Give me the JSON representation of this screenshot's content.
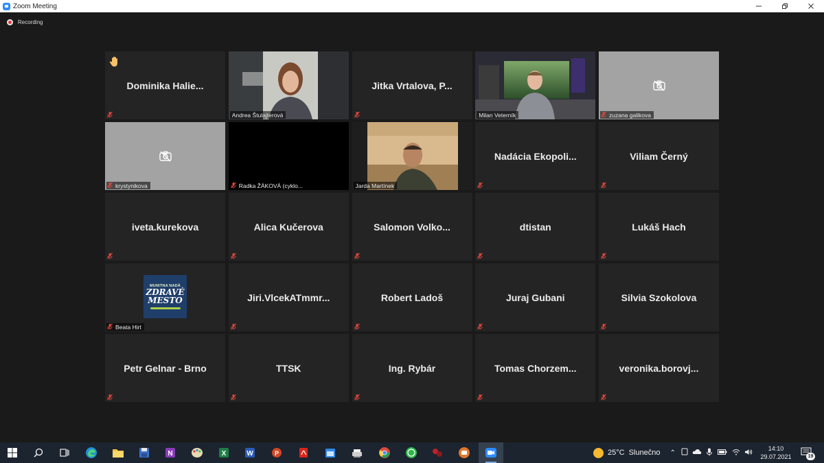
{
  "window": {
    "title": "Zoom Meeting"
  },
  "recording": {
    "label": "Recording"
  },
  "participants": [
    {
      "name": "Dominika  Halie...",
      "display": "name",
      "hand_raised": true,
      "muted": true
    },
    {
      "name": "Andrea Štulajterová",
      "display": "video",
      "active_speaker": true
    },
    {
      "name": "Jitka  Vrtalova,  P...",
      "display": "name",
      "muted": true
    },
    {
      "name": "Milan Veterník",
      "display": "video"
    },
    {
      "name": "zuzana galikova",
      "display": "camera-off",
      "muted": true
    },
    {
      "name": "krystynikova",
      "display": "camera-off",
      "muted": true
    },
    {
      "name": "Radka ŽÁKOVÁ (cyklo...",
      "display": "black",
      "muted": true
    },
    {
      "name": "Jarda Martínek",
      "display": "video"
    },
    {
      "name": "Nadácia  Ekopoli...",
      "display": "name",
      "muted": true
    },
    {
      "name": "Viliam Černý",
      "display": "name",
      "muted": true
    },
    {
      "name": "iveta.kurekova",
      "display": "name",
      "muted": true
    },
    {
      "name": "Alica Kučerova",
      "display": "name",
      "muted": true
    },
    {
      "name": "Salomon  Volko...",
      "display": "name",
      "muted": true
    },
    {
      "name": "dtistan",
      "display": "name",
      "muted": true
    },
    {
      "name": "Lukáš Hach",
      "display": "name",
      "muted": true
    },
    {
      "name": "Beata Hirt",
      "display": "logo",
      "muted": true,
      "logo_text": [
        "MUNITNA NADÁ",
        "ZDRAVÉ",
        "MESTO"
      ]
    },
    {
      "name": "Jiri.VlcekATmmr...",
      "display": "name",
      "muted": true
    },
    {
      "name": "Robert Ladoš",
      "display": "name",
      "muted": true
    },
    {
      "name": "Juraj Gubani",
      "display": "name",
      "muted": true
    },
    {
      "name": "Silvia Szokolova",
      "display": "name",
      "muted": true
    },
    {
      "name": "Petr Gelnar - Brno",
      "display": "name",
      "muted": true
    },
    {
      "name": "TTSK",
      "display": "name",
      "muted": true
    },
    {
      "name": "Ing. Rybár",
      "display": "name",
      "muted": true
    },
    {
      "name": "Tomas  Chorzem...",
      "display": "name",
      "muted": true
    },
    {
      "name": "veronika.borovj...",
      "display": "name",
      "muted": true
    }
  ],
  "taskbar": {
    "apps": [
      "start-icon",
      "search-icon",
      "task-view-icon",
      "edge-icon",
      "file-explorer-icon",
      "save-icon",
      "onenote-icon",
      "paint-icon",
      "excel-icon",
      "word-icon",
      "powerpoint-icon",
      "acrobat-icon",
      "calendar-icon",
      "scanner-icon",
      "chrome-icon",
      "whatsapp-icon",
      "app-red-icon",
      "app-orange-icon",
      "zoom-icon"
    ],
    "weather": {
      "temp": "25°C",
      "condition": "Slunečno"
    },
    "time": "14:10",
    "date": "29.07.2021",
    "notifications": "19"
  },
  "colors": {
    "tile_bg": "#242424",
    "active_border": "#d6e868",
    "mute_red": "#e0463c",
    "taskbar_bg": "#1c2430"
  }
}
